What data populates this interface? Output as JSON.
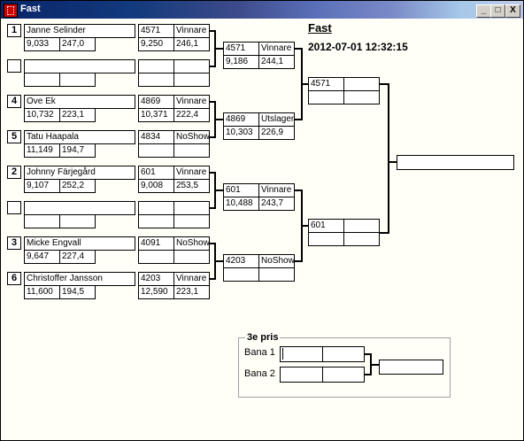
{
  "window": {
    "title": "Fast",
    "minimize": "_",
    "maximize": "□",
    "close": "X"
  },
  "header": {
    "title": "Fast",
    "datetime": "2012-07-01 12:32:15"
  },
  "seeds": [
    "1",
    "4",
    "5",
    "2",
    "3",
    "6"
  ],
  "round1": [
    {
      "name": "Janne Selinder",
      "a": "9,033",
      "b": "247,0",
      "car": "4571",
      "status": "Vinnare",
      "c": "9,250",
      "d": "246,1"
    },
    {
      "name": "Ove Ek",
      "a": "10,732",
      "b": "223,1",
      "car": "4869",
      "status": "Vinnare",
      "c": "10,371",
      "d": "222,4"
    },
    {
      "name": "Tatu Haapala",
      "a": "11,149",
      "b": "194,7",
      "car": "4834",
      "status": "NoShow",
      "c": "",
      "d": ""
    },
    {
      "name": "Johnny Färjegård",
      "a": "9,107",
      "b": "252,2",
      "car": "601",
      "status": "Vinnare",
      "c": "9,008",
      "d": "253,5"
    },
    {
      "name": "Micke Engvall",
      "a": "9,647",
      "b": "227,4",
      "car": "4091",
      "status": "NoShow",
      "c": "",
      "d": ""
    },
    {
      "name": "Christoffer Jansson",
      "a": "11,600",
      "b": "194,5",
      "car": "4203",
      "status": "Vinnare",
      "c": "12,590",
      "d": "223,1"
    }
  ],
  "round2": [
    {
      "car": "4571",
      "status": "Vinnare",
      "a": "9,186",
      "b": "244,1"
    },
    {
      "car": "4869",
      "status": "Utslagen",
      "a": "10,303",
      "b": "226,9"
    },
    {
      "car": "601",
      "status": "Vinnare",
      "a": "10,488",
      "b": "243,7"
    },
    {
      "car": "4203",
      "status": "NoShow",
      "a": "",
      "b": ""
    }
  ],
  "round3": [
    {
      "car": "4571"
    },
    {
      "car": "601"
    }
  ],
  "third_place": {
    "title": "3e pris",
    "lane1": "Bana 1",
    "lane2": "Bana 2"
  }
}
